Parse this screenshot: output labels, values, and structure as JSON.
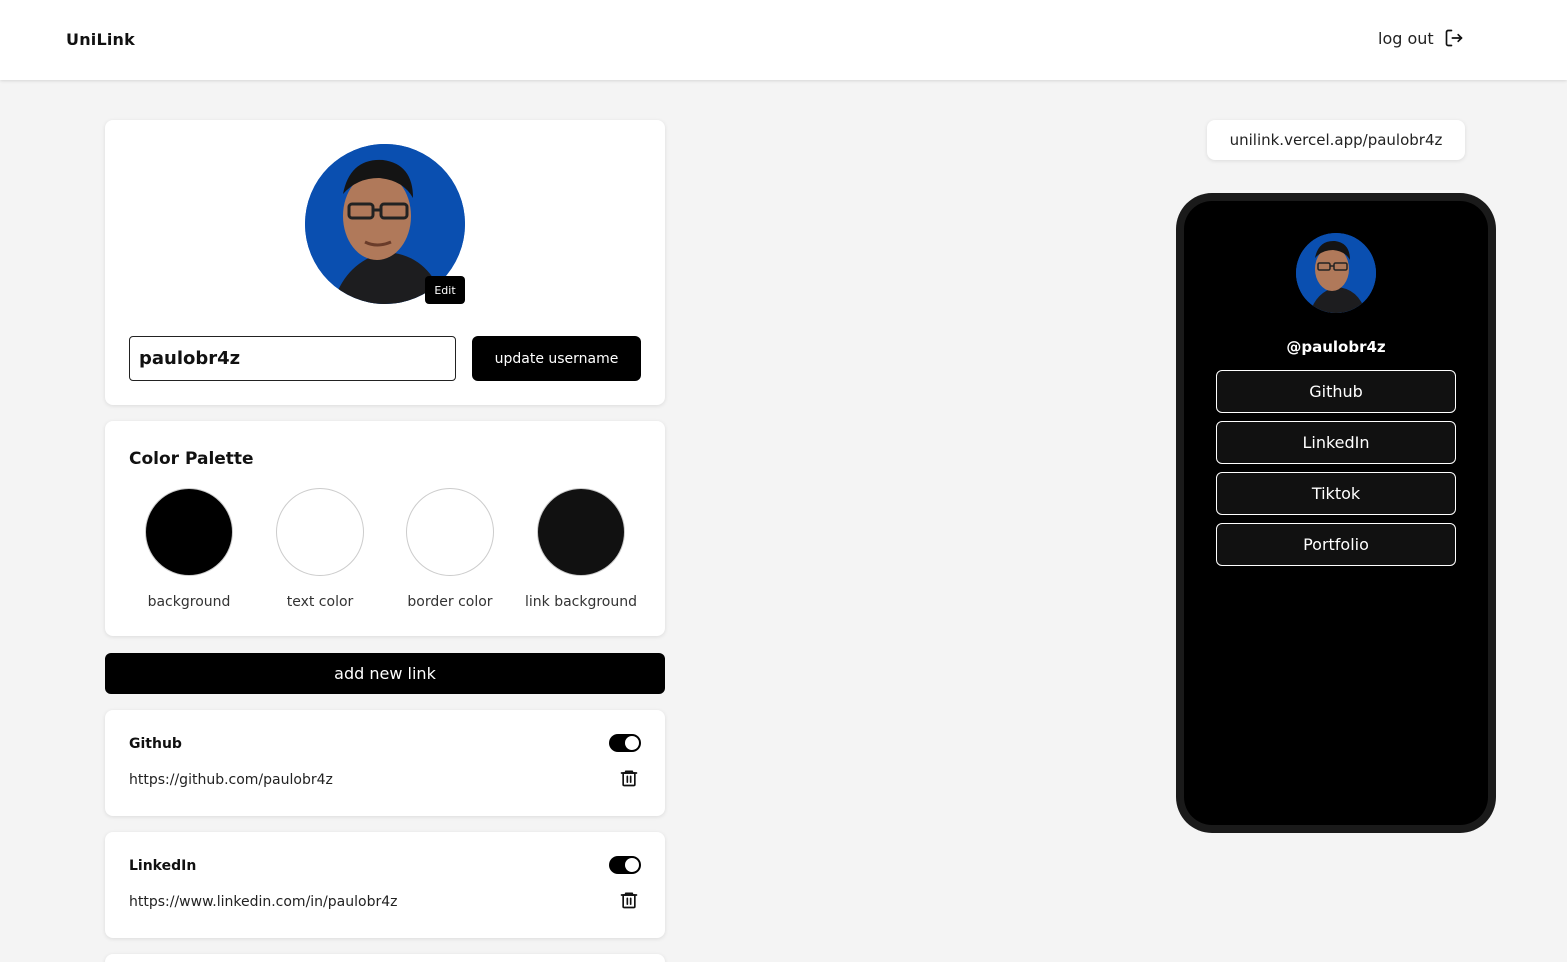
{
  "header": {
    "brand": "UniLink",
    "logout_label": "log out"
  },
  "profile": {
    "edit_label": "Edit",
    "username_value": "paulobr4z",
    "update_label": "update username"
  },
  "palette": {
    "title": "Color Palette",
    "swatches": [
      {
        "label": "background",
        "color": "#000000"
      },
      {
        "label": "text color",
        "color": "#ffffff"
      },
      {
        "label": "border color",
        "color": "#ffffff"
      },
      {
        "label": "link background",
        "color": "#111111"
      }
    ]
  },
  "add_link_label": "add new link",
  "links": [
    {
      "title": "Github",
      "url": "https://github.com/paulobr4z",
      "enabled": true
    },
    {
      "title": "LinkedIn",
      "url": "https://www.linkedin.com/in/paulobr4z",
      "enabled": true
    }
  ],
  "preview": {
    "public_url": "unilink.vercel.app/paulobr4z",
    "handle": "@paulobr4z",
    "buttons": [
      "Github",
      "LinkedIn",
      "Tiktok",
      "Portfolio"
    ]
  },
  "colors": {
    "accent": "#000000",
    "avatar_bg": "#0a4fb0",
    "page_bg": "#f4f4f4"
  }
}
